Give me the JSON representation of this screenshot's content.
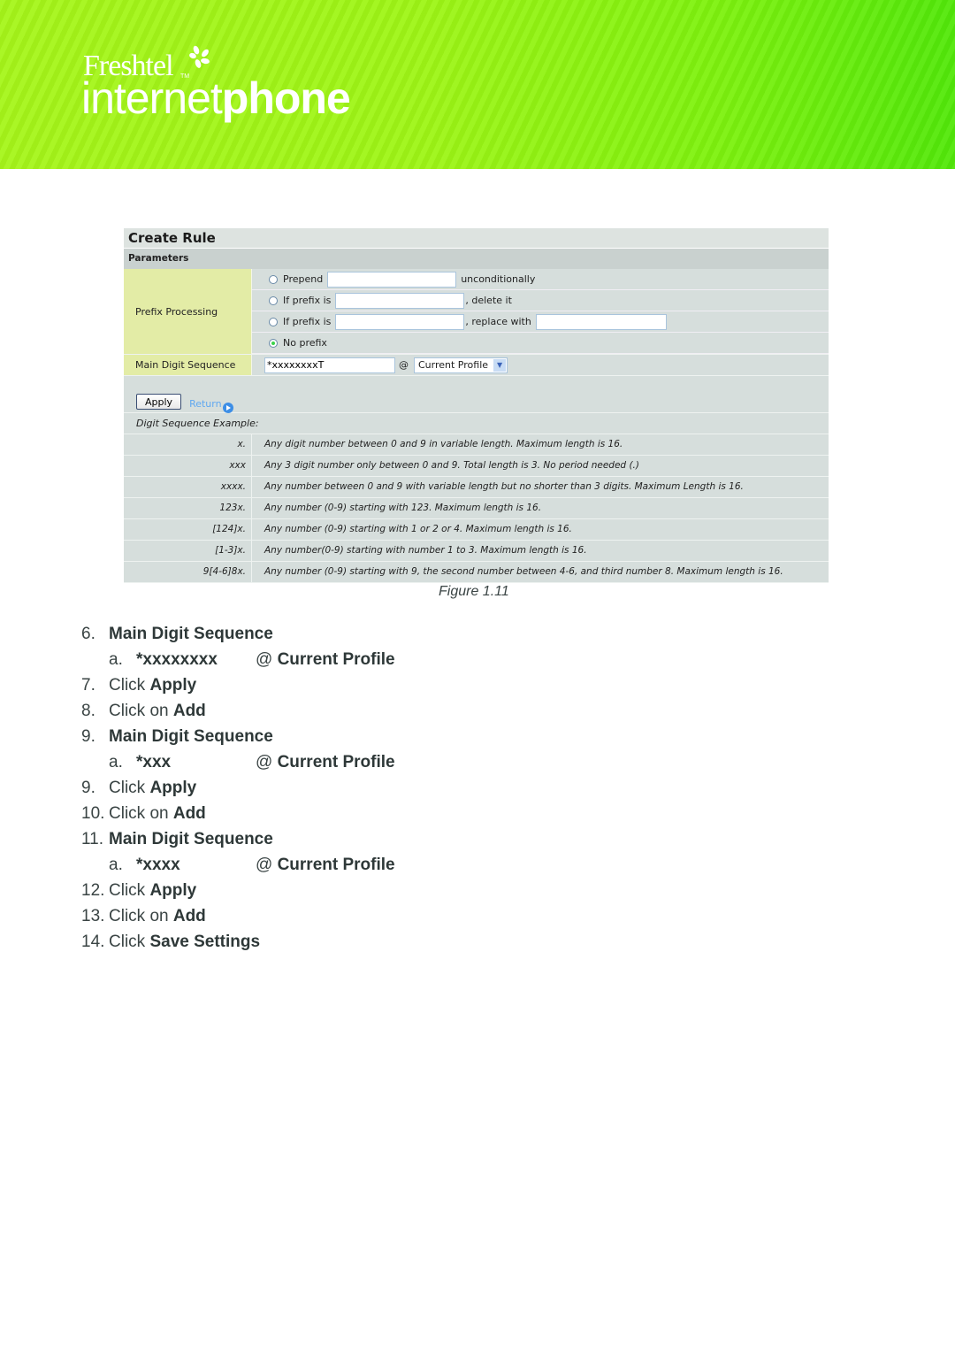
{
  "header": {
    "brand": "Freshtel",
    "trademark": "TM",
    "product_light": "internet",
    "product_bold": "phone",
    "colors": {
      "green_light": "#a6f51a",
      "green_dark": "#52e80a"
    }
  },
  "create_rule": {
    "title": "Create Rule",
    "section": "Parameters",
    "prefix_processing": {
      "label": "Prefix Processing",
      "options": [
        {
          "label": "Prepend",
          "selected": false,
          "input_value": "",
          "suffix": "unconditionally"
        },
        {
          "label": "If prefix is",
          "selected": false,
          "input_value": "",
          "suffix": ", delete it"
        },
        {
          "label": "If prefix is",
          "selected": false,
          "input_value": "",
          "suffix": ", replace with",
          "replace_value": ""
        },
        {
          "label": "No prefix",
          "selected": true
        }
      ]
    },
    "main_digit_sequence": {
      "label": "Main Digit Sequence",
      "value": "*xxxxxxxxT",
      "at": "@",
      "profile_selected": "Current Profile"
    },
    "apply_label": "Apply",
    "return_label": "Return",
    "example_heading": "Digit Sequence Example:",
    "examples": [
      {
        "code": "x.",
        "desc": "Any digit number between 0 and 9 in variable length. Maximum length is 16."
      },
      {
        "code": "xxx",
        "desc": "Any 3 digit number only between 0 and 9. Total length is 3. No period needed (.)"
      },
      {
        "code": "xxxx.",
        "desc": "Any number between 0 and 9 with variable length but no shorter than 3 digits. Maximum Length is 16."
      },
      {
        "code": "123x.",
        "desc": "Any number (0-9) starting with 123. Maximum length is 16."
      },
      {
        "code": "[124]x.",
        "desc": "Any number (0-9) starting with 1 or 2 or 4. Maximum length is 16."
      },
      {
        "code": "[1-3]x.",
        "desc": "Any number(0-9) starting with number 1 to 3. Maximum length is 16."
      },
      {
        "code": "9[4-6]8x.",
        "desc": "Any number (0-9) starting with 9, the second number between 4-6, and third number 8. Maximum length is 16."
      }
    ]
  },
  "figure_caption": "Figure 1.11",
  "steps": [
    {
      "type": "main",
      "num": "6.",
      "pre": "",
      "bold": "Main Digit Sequence"
    },
    {
      "type": "sub",
      "letter": "a.",
      "seq": "*xxxxxxxx",
      "at": "@",
      "profile": "Current Profile"
    },
    {
      "type": "main",
      "num": "7.",
      "pre": "Click ",
      "bold": "Apply"
    },
    {
      "type": "main",
      "num": "8.",
      "pre": "Click on ",
      "bold": "Add"
    },
    {
      "type": "main",
      "num": "9.",
      "pre": "",
      "bold": "Main Digit Sequence"
    },
    {
      "type": "sub",
      "letter": "a.",
      "seq": "*xxx",
      "at": "@",
      "profile": "Current Profile"
    },
    {
      "type": "main",
      "num": "9.",
      "pre": "Click ",
      "bold": "Apply"
    },
    {
      "type": "main",
      "num": "10.",
      "pre": "Click on ",
      "bold": "Add"
    },
    {
      "type": "main",
      "num": "11.",
      "pre": "",
      "bold": "Main Digit Sequence"
    },
    {
      "type": "sub",
      "letter": "a.",
      "seq": "*xxxx",
      "at": "@",
      "profile": "Current Profile"
    },
    {
      "type": "main",
      "num": "12.",
      "pre": "Click ",
      "bold": "Apply"
    },
    {
      "type": "main",
      "num": "13.",
      "pre": "Click on ",
      "bold": "Add"
    },
    {
      "type": "main",
      "num": "14.",
      "pre": "Click ",
      "bold": "Save Settings"
    }
  ]
}
